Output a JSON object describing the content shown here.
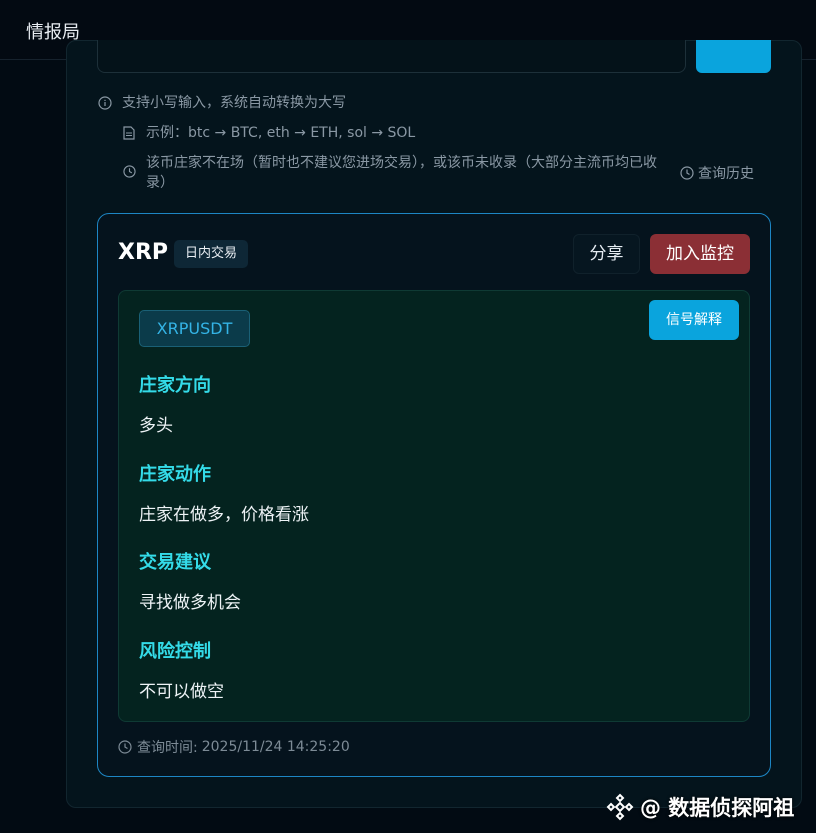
{
  "app": {
    "title": "情报局"
  },
  "search": {
    "tip": "支持小写输入，系统自动转换为大写",
    "example": "示例：btc → BTC, eth → ETH, sol → SOL",
    "status": "该币庄家不在场（暂时也不建议您进场交易），或该币未收录（大部分主流币均已收录）",
    "history_label": "查询历史"
  },
  "result": {
    "symbol": "XRP",
    "mode": "日内交易",
    "share_label": "分享",
    "monitor_label": "加入监控",
    "pair": "XRPUSDT",
    "explain_label": "信号解释",
    "sections": [
      {
        "label": "庄家方向",
        "value": "多头"
      },
      {
        "label": "庄家动作",
        "value": "庄家在做多，价格看涨"
      },
      {
        "label": "交易建议",
        "value": "寻找做多机会"
      },
      {
        "label": "风险控制",
        "value": "不可以做空"
      }
    ],
    "query_time_label": "查询时间:",
    "query_time": "2025/11/24 14:25:20"
  },
  "watermark": {
    "text": "@ 数据侦探阿祖"
  },
  "colors": {
    "accent_blue": "#0aa4dd",
    "monitor_red": "#8b2f35",
    "section_cyan": "#34dbe8",
    "card_border": "#1d86c4"
  }
}
